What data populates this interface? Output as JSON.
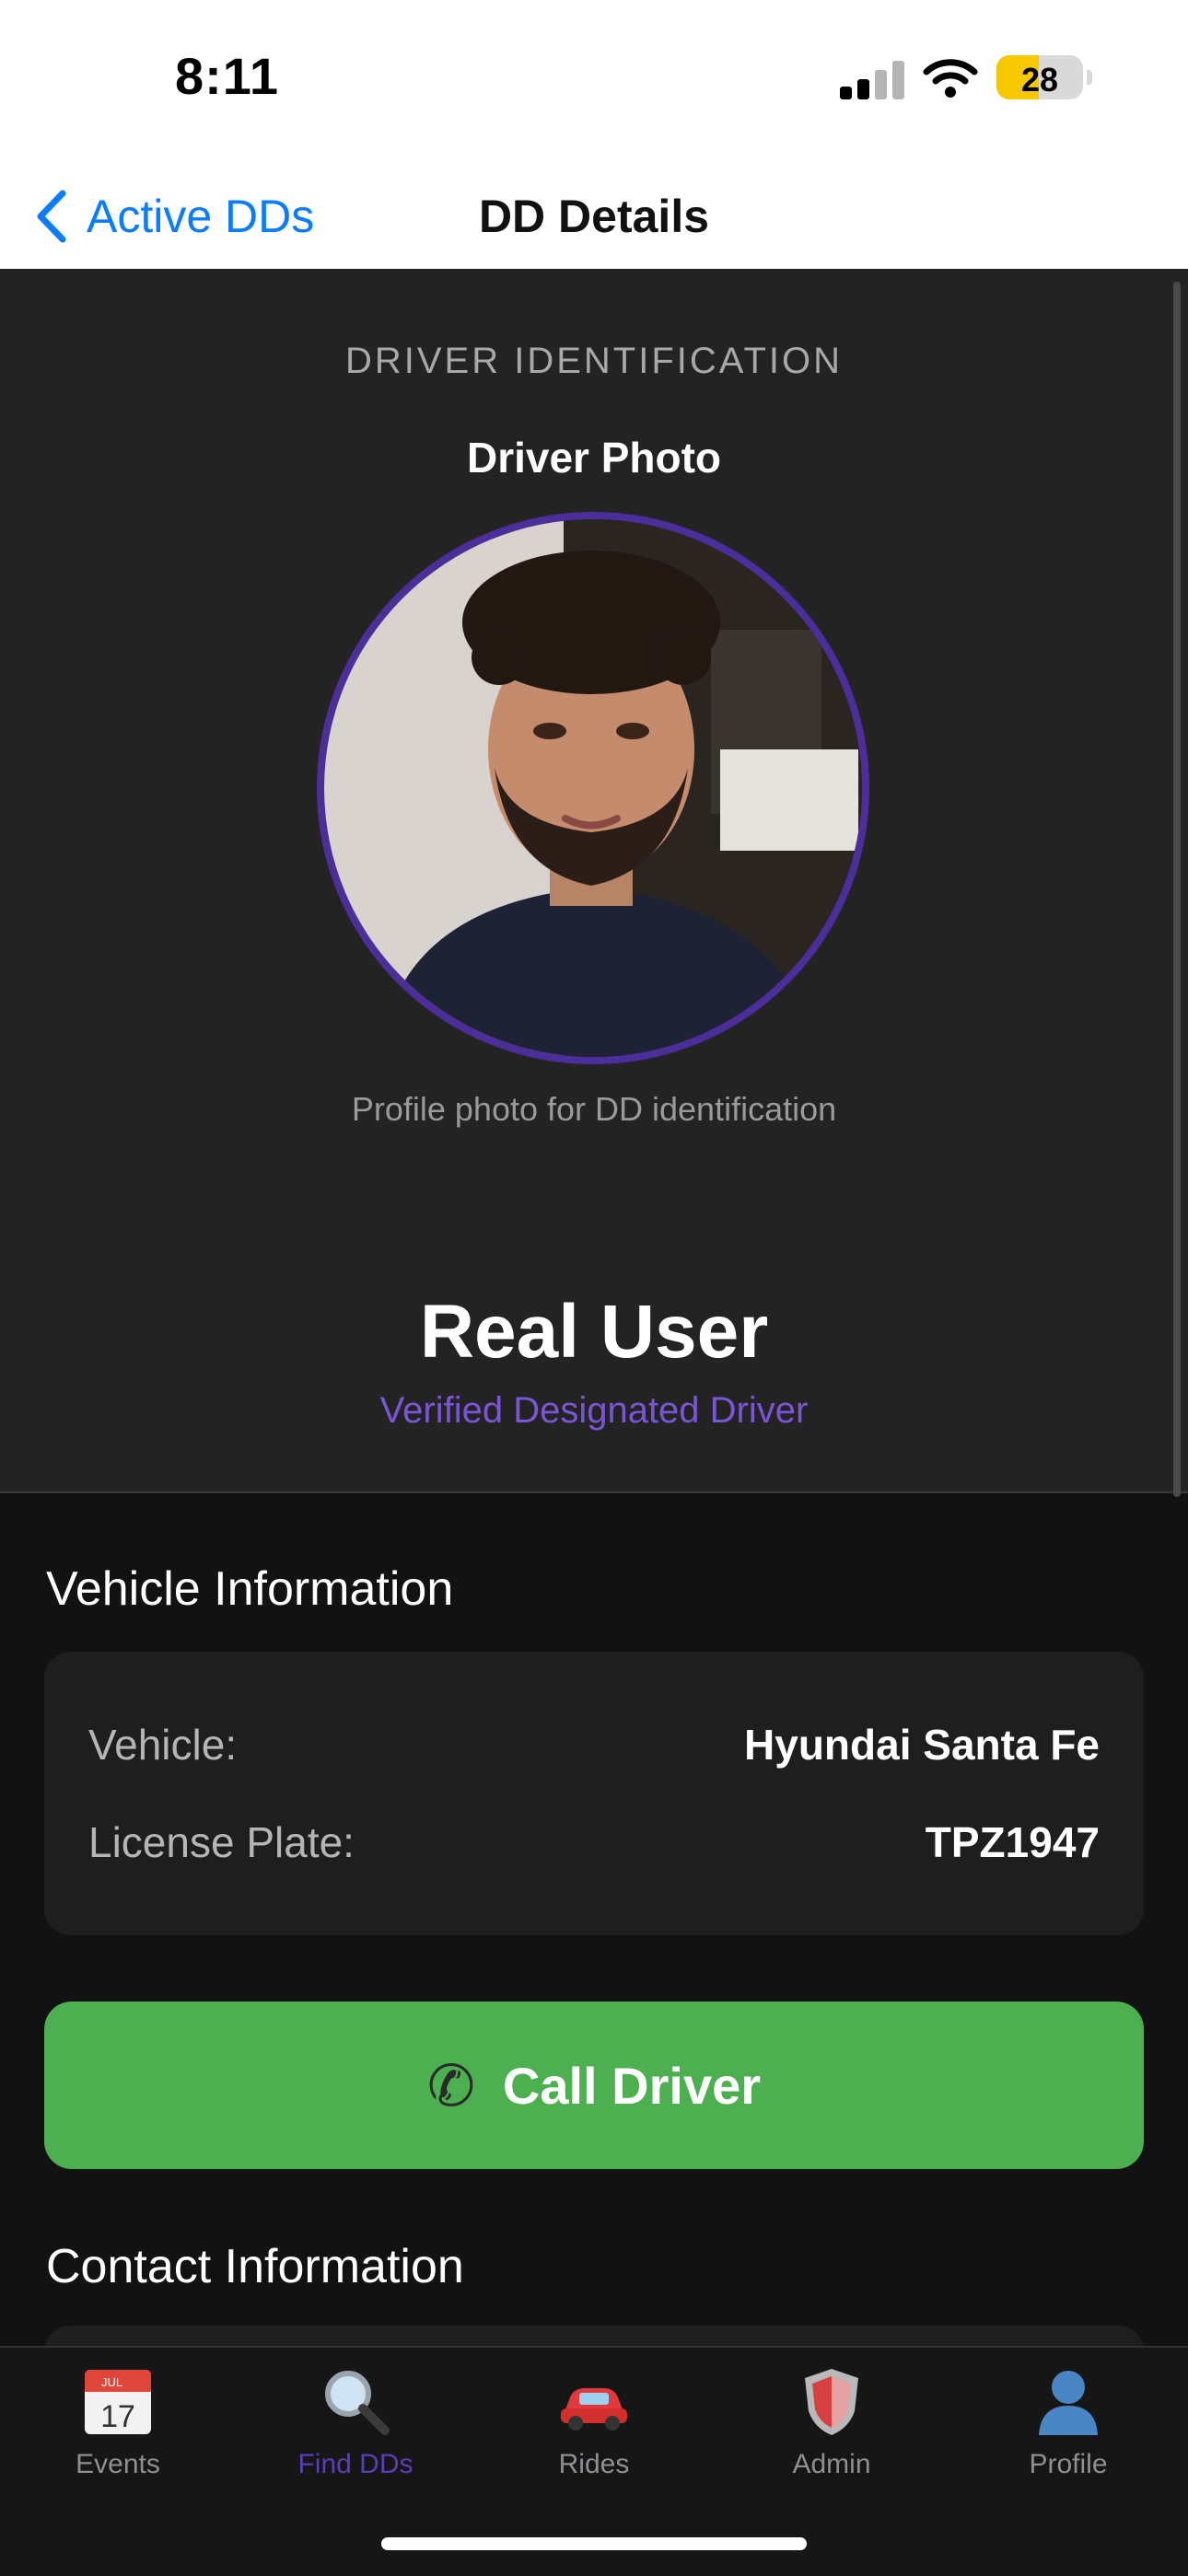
{
  "status_bar": {
    "time": "8:11",
    "battery": "28"
  },
  "nav": {
    "back_label": "Active DDs",
    "title": "DD Details"
  },
  "identification": {
    "section_header": "DRIVER IDENTIFICATION",
    "photo_title": "Driver Photo",
    "photo_caption": "Profile photo for DD identification",
    "driver_name": "Real User",
    "verified_label": "Verified Designated Driver"
  },
  "vehicle": {
    "header": "Vehicle Information",
    "rows": [
      {
        "label": "Vehicle:",
        "value": "Hyundai Santa Fe"
      },
      {
        "label": "License Plate:",
        "value": "TPZ1947"
      }
    ]
  },
  "call_button": {
    "icon": "phone-icon",
    "label": "Call Driver"
  },
  "contact": {
    "header": "Contact Information"
  },
  "tab_bar": {
    "items": [
      {
        "label": "Events",
        "icon": "calendar-icon",
        "calendar_month": "JUL",
        "calendar_day": "17"
      },
      {
        "label": "Find DDs",
        "icon": "magnifier-icon",
        "active": true
      },
      {
        "label": "Rides",
        "icon": "car-icon"
      },
      {
        "label": "Admin",
        "icon": "shield-icon"
      },
      {
        "label": "Profile",
        "icon": "person-icon"
      }
    ]
  },
  "colors": {
    "accent": "#0a7cff",
    "purple": "#7a55d6",
    "call_green": "#4caf50",
    "battery_yellow": "#f5c800"
  }
}
